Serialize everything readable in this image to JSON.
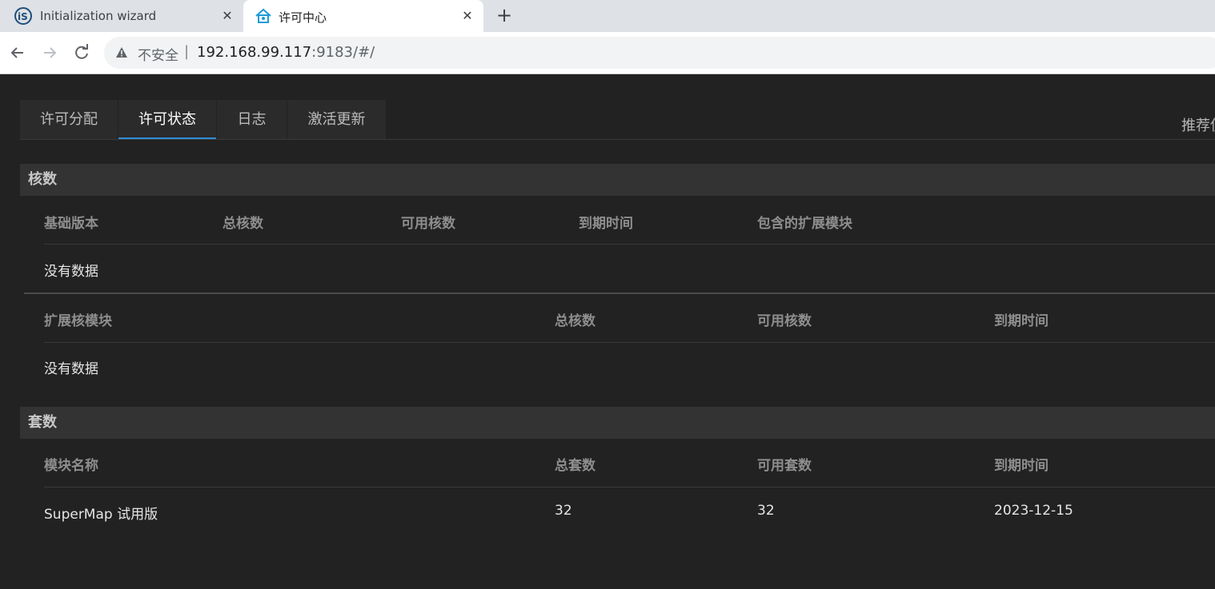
{
  "browser": {
    "tabs": [
      {
        "title": "Initialization wizard",
        "favicon": "supermap-logo-icon",
        "active": false
      },
      {
        "title": "许可中心",
        "favicon": "license-center-icon",
        "active": true
      }
    ],
    "omnibox": {
      "security_label": "不安全",
      "separator": "|",
      "url_host": "192.168.99.117",
      "url_rest": ":9183/#/"
    }
  },
  "app": {
    "tabs": [
      "许可分配",
      "许可状态",
      "日志",
      "激活更新"
    ],
    "active_tab": "许可状态",
    "right_label": "推荐使",
    "accent_color": "#2f8fd8",
    "cores_section": {
      "title": "核数",
      "base_table": {
        "headers": [
          "基础版本",
          "总核数",
          "可用核数",
          "到期时间",
          "包含的扩展模块"
        ],
        "empty_text": "没有数据"
      },
      "ext_table": {
        "headers": [
          "扩展核模块",
          "总核数",
          "可用核数",
          "到期时间"
        ],
        "empty_text": "没有数据"
      }
    },
    "sets_section": {
      "title": "套数",
      "headers": [
        "模块名称",
        "总套数",
        "可用套数",
        "到期时间"
      ],
      "rows": [
        {
          "name": "SuperMap 试用版",
          "total": "32",
          "available": "32",
          "expires": "2023-12-15"
        }
      ]
    }
  }
}
